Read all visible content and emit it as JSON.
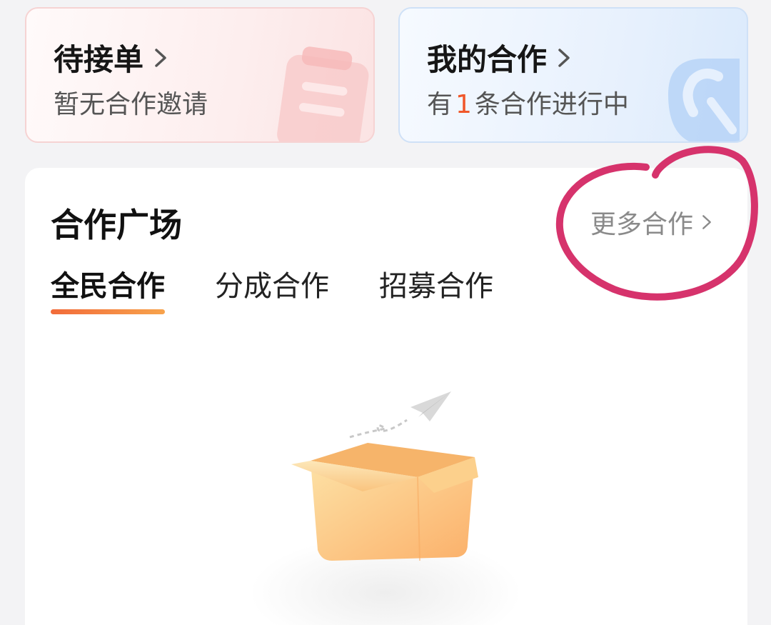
{
  "cards": {
    "pending": {
      "title": "待接单",
      "subtitle": "暂无合作邀请"
    },
    "mine": {
      "title": "我的合作",
      "subtitle_prefix": "有",
      "count": "1",
      "subtitle_suffix": "条合作进行中"
    }
  },
  "square": {
    "title": "合作广场",
    "more_label": "更多合作",
    "tabs": [
      {
        "label": "全民合作",
        "active": true
      },
      {
        "label": "分成合作",
        "active": false
      },
      {
        "label": "招募合作",
        "active": false
      }
    ]
  },
  "colors": {
    "accent": "#f0572a",
    "annotation_circle": "#d6336c"
  },
  "icons": {
    "chevron": "chevron-right-icon",
    "pending_deco": "clipboard-icon",
    "mine_deco": "handshake-icon",
    "empty": "empty-box-icon"
  }
}
